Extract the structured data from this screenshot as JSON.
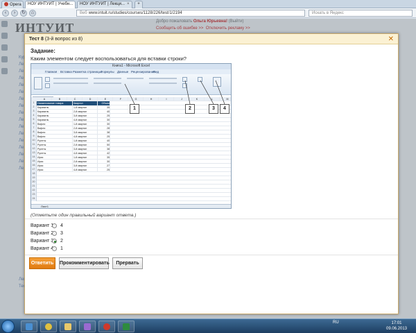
{
  "browser": {
    "tabs": [
      {
        "label": "Opera",
        "active": false
      },
      {
        "label": "НОУ ИНТУИТ | Учебн...",
        "active": true
      },
      {
        "label": "НОУ ИНТУИТ | Лекци...",
        "active": false
      }
    ],
    "new_tab_symbol": "+",
    "url_prefix": "Веб",
    "url": "www.intuit.ru/studies/courses/1128/226/test/1/2194",
    "search_placeholder": "Искать в Яндекс",
    "nav_icons": [
      "back-icon",
      "forward-icon",
      "reload-icon",
      "home-icon"
    ]
  },
  "site": {
    "logo": "ИНТУИТ",
    "user_greeting": "Добро пожаловать",
    "user_name": "Ольга Юрьевна!",
    "logout": "(Выйти)",
    "report_error": "Сообщить об ошибке >>",
    "disable_ads": "Отключить рекламу >>",
    "left_items": [
      "Кур",
      "Ле",
      "Ле",
      "Ле",
      "Ле",
      "Ле",
      "Ле",
      "Ле",
      "Ле",
      "Ле",
      "Ле",
      "Ле",
      "Ле",
      "Ле",
      "Ле",
      "Ле",
      "Ле",
      "Лекция 14",
      "Тест 14"
    ]
  },
  "modal": {
    "title": "Тест 8",
    "subtitle": "(3-й вопрос из 8)",
    "close_symbol": "✕",
    "task_label": "Задание:",
    "question": "Каким элементом следует воспользоваться для вставки строки?",
    "instruction": "(Отметьте один правильный вариант ответа.)",
    "options": [
      {
        "label": "Вариант 1",
        "value": "4",
        "selected": false
      },
      {
        "label": "Вариант 2",
        "value": "3",
        "selected": false
      },
      {
        "label": "Вариант 3",
        "value": "2",
        "selected": true
      },
      {
        "label": "Вариант 4",
        "value": "1",
        "selected": false
      }
    ],
    "buttons": {
      "answer": "Ответить",
      "comment": "Прокомментировать",
      "abort": "Прервать"
    }
  },
  "excel": {
    "title": "Книга1 - Microsoft Excel",
    "tabs": [
      "Главная",
      "Вставка",
      "Разметка страницы",
      "Формулы",
      "Данные",
      "Рецензирование",
      "Вид"
    ],
    "namebox": "A1",
    "formula": "Наименование товара",
    "col_headers": [
      "A",
      "B",
      "C",
      "D",
      "E",
      "F",
      "G",
      "H",
      "I",
      "J",
      "K",
      "L",
      "M"
    ],
    "header_row": [
      "Наименование товара",
      "Квартал",
      "Объем"
    ],
    "rows": [
      [
        "Карамель",
        "1-й квартал",
        "35"
      ],
      [
        "Карамель",
        "2-й квартал",
        "40"
      ],
      [
        "Карамель",
        "3-й квартал",
        "25"
      ],
      [
        "Карамель",
        "4-й квартал",
        "30"
      ],
      [
        "Вафли",
        "1-й квартал",
        "30"
      ],
      [
        "Вафли",
        "2-й квартал",
        "28"
      ],
      [
        "Вафли",
        "3-й квартал",
        "38"
      ],
      [
        "Вафли",
        "4-й квартал",
        "25"
      ],
      [
        "Рулеты",
        "1-й квартал",
        "40"
      ],
      [
        "Рулеты",
        "2-й квартал",
        "50"
      ],
      [
        "Рулеты",
        "3-й квартал",
        "38"
      ],
      [
        "Рулеты",
        "4-й квартал",
        "42"
      ],
      [
        "Ирис",
        "1-й квартал",
        "35"
      ],
      [
        "Ирис",
        "2-й квартал",
        "30"
      ],
      [
        "Ирис",
        "3-й квартал",
        "27"
      ],
      [
        "Ирис",
        "4-й квартал",
        "25"
      ]
    ],
    "sheet_tabs": "Лист1",
    "callouts": [
      "1",
      "2",
      "3",
      "4"
    ]
  },
  "taskbar": {
    "language": "RU",
    "time": "17:01",
    "date": "09.06.2013",
    "apps": [
      "explorer-icon",
      "chrome-icon",
      "folder-icon",
      "media-icon",
      "opera-icon",
      "excel-icon"
    ]
  }
}
